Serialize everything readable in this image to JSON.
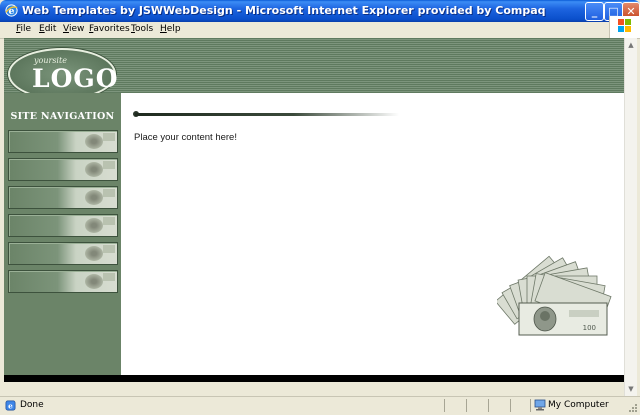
{
  "window": {
    "title": "Web Templates by JSWWebDesign - Microsoft Internet Explorer provided by Compaq",
    "buttons": {
      "minimize": "_",
      "maximize": "□",
      "close": "✕"
    }
  },
  "menu": {
    "items": [
      {
        "label": "File",
        "accel": "F",
        "rest": "ile"
      },
      {
        "label": "Edit",
        "accel": "E",
        "rest": "dit"
      },
      {
        "label": "View",
        "accel": "V",
        "rest": "iew"
      },
      {
        "label": "Favorites",
        "accel": "F",
        "rest": "avorites"
      },
      {
        "label": "Tools",
        "accel": "T",
        "rest": "ools"
      },
      {
        "label": "Help",
        "accel": "H",
        "rest": "elp"
      }
    ]
  },
  "page": {
    "logo": {
      "small": "yoursite",
      "big": "LOGO"
    },
    "nav_title": "SITE NAVIGATION",
    "nav_buttons": 6,
    "content_text": "Place your content here!"
  },
  "status": {
    "left": "Done",
    "zone": "My Computer"
  },
  "colors": {
    "sidebar": "#6b8468",
    "header": "#6a846a",
    "titlebar": "#1d64e0"
  }
}
